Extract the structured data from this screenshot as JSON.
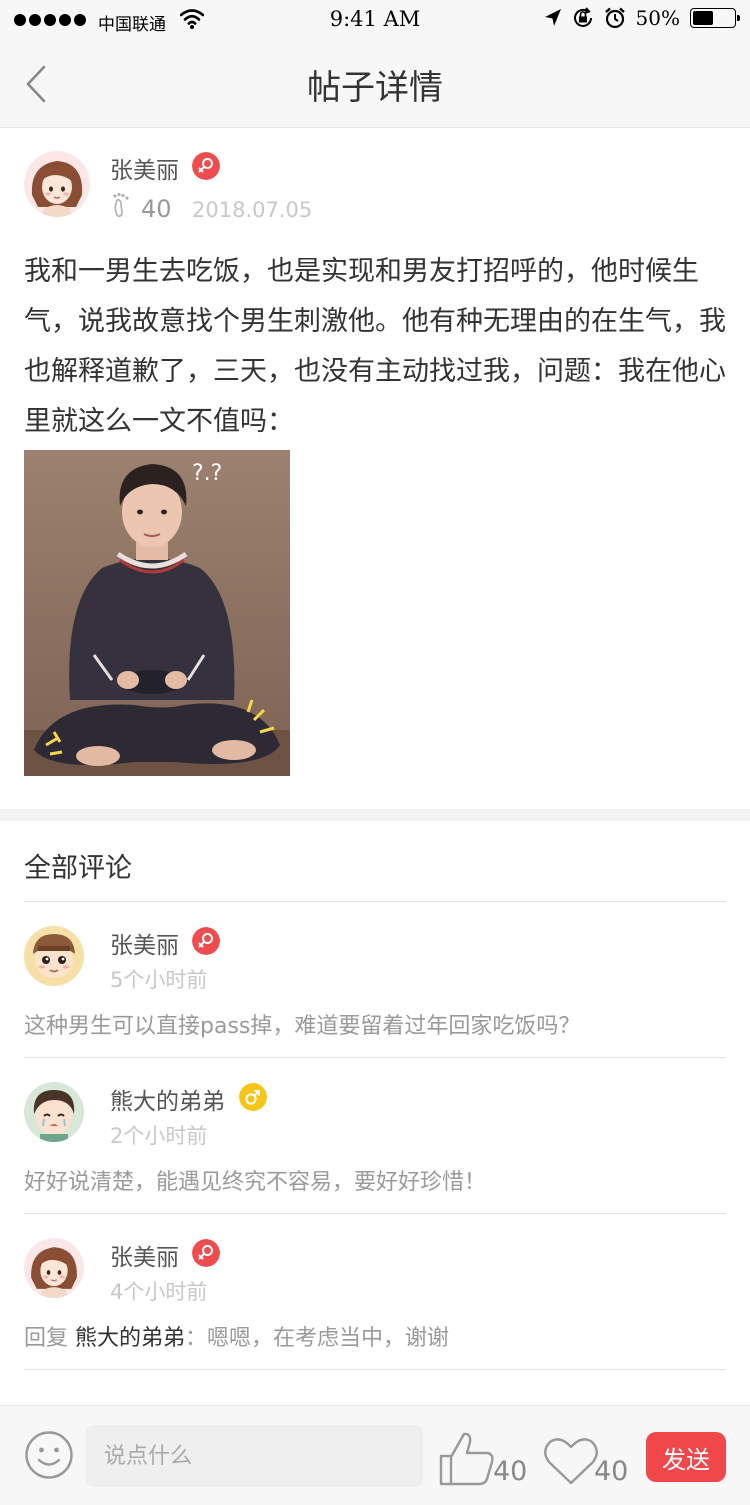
{
  "status_bar": {
    "carrier": "中国联通",
    "time": "9:41 AM",
    "battery_text": "50%",
    "battery_level": 0.5
  },
  "nav": {
    "title": "帖子详情",
    "back_icon": "chevron-left-icon"
  },
  "post": {
    "author": "张美丽",
    "author_gender": "female",
    "footprint_count": "40",
    "date": "2018.07.05",
    "text": "我和一男生去吃饭，也是实现和男友打招呼的，他时候生气，说我故意找个男生刺激他。他有种无理由的在生气，我也解释道歉了，三天，也没有主动找过我，问题：我在他心里就这么一文不值吗："
  },
  "comments": {
    "title": "全部评论",
    "items": [
      {
        "author": "张美丽",
        "gender": "female",
        "time": "5个小时前",
        "text": "这种男生可以直接pass掉，难道要留着过年回家吃饭吗？"
      },
      {
        "author": "熊大的弟弟",
        "gender": "male",
        "time": "2个小时前",
        "text": "好好说清楚，能遇见终究不容易，要好好珍惜！"
      },
      {
        "author": "张美丽",
        "gender": "female",
        "time": "4个小时前",
        "reply_prefix": "回复 ",
        "reply_to": "熊大的弟弟",
        "text": "：嗯嗯，在考虑当中，谢谢"
      }
    ]
  },
  "bottom_bar": {
    "input_placeholder": "说点什么",
    "like_count": "40",
    "fav_count": "40",
    "send_label": "发送"
  },
  "colors": {
    "accent_red": "#f0474b",
    "male_yellow": "#f5c518",
    "female_red": "#ee4c4f"
  }
}
